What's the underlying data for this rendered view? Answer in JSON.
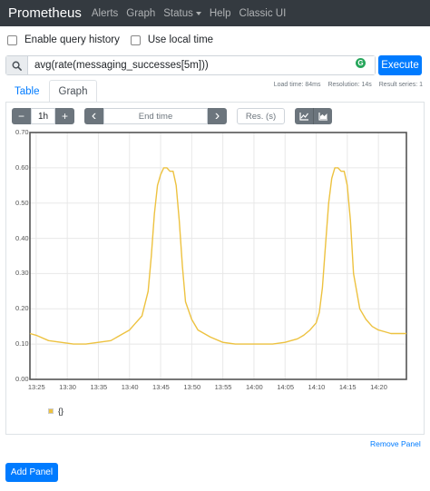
{
  "navbar": {
    "brand": "Prometheus",
    "links": [
      "Alerts",
      "Graph",
      "Status",
      "Help",
      "Classic UI"
    ]
  },
  "options": {
    "query_history_label": "Enable query history",
    "local_time_label": "Use local time"
  },
  "query": {
    "expression": "avg(rate(messaging_successes[5m]))",
    "badge": "G",
    "execute_label": "Execute"
  },
  "stats": {
    "load_time": "Load time: 84ms",
    "resolution": "Resolution: 14s",
    "result_series": "Result series: 1"
  },
  "tabs": [
    "Table",
    "Graph"
  ],
  "graph_controls": {
    "minus": "−",
    "range": "1h",
    "plus": "+",
    "prev": "‹",
    "end_time_placeholder": "End time",
    "next": "›",
    "resolution_placeholder": "Res. (s)"
  },
  "chart_data": {
    "type": "line",
    "y_ticks": [
      "0.00",
      "0.10",
      "0.20",
      "0.30",
      "0.40",
      "0.50",
      "0.60",
      "0.70"
    ],
    "ylim": [
      0,
      0.7
    ],
    "x_ticks": [
      "13:25",
      "13:30",
      "13:35",
      "13:40",
      "13:45",
      "13:50",
      "13:55",
      "14:00",
      "14:05",
      "14:10",
      "14:15",
      "14:20"
    ],
    "x_ticks_minutes": [
      0,
      5,
      10,
      15,
      20,
      25,
      30,
      35,
      40,
      45,
      50,
      55
    ],
    "xlim_minutes": [
      -1,
      59.5
    ],
    "grid": true,
    "series": [
      {
        "name": "{}",
        "color": "#edc240",
        "x_minutes": [
          -1,
          0,
          2,
          4,
          6,
          8,
          10,
          12,
          14,
          15,
          16,
          17,
          18,
          18.5,
          19,
          19.5,
          20,
          20.5,
          21,
          21.5,
          22,
          22.5,
          23,
          23.5,
          24,
          25,
          26,
          28,
          30,
          32,
          34,
          36,
          38,
          40,
          42,
          43,
          44,
          45,
          45.5,
          46,
          46.5,
          47,
          47.5,
          48,
          48.5,
          49,
          49.5,
          50,
          50.5,
          51,
          52,
          53,
          54,
          55,
          56,
          57,
          58,
          59,
          59.5
        ],
        "values": [
          0.13,
          0.125,
          0.11,
          0.105,
          0.1,
          0.1,
          0.105,
          0.11,
          0.13,
          0.14,
          0.16,
          0.18,
          0.25,
          0.35,
          0.47,
          0.55,
          0.58,
          0.6,
          0.6,
          0.59,
          0.59,
          0.55,
          0.45,
          0.32,
          0.22,
          0.17,
          0.14,
          0.12,
          0.105,
          0.1,
          0.1,
          0.1,
          0.1,
          0.105,
          0.115,
          0.125,
          0.14,
          0.16,
          0.19,
          0.26,
          0.38,
          0.5,
          0.57,
          0.6,
          0.6,
          0.59,
          0.59,
          0.55,
          0.45,
          0.3,
          0.2,
          0.17,
          0.15,
          0.14,
          0.135,
          0.13,
          0.13,
          0.13,
          0.13
        ]
      }
    ]
  },
  "legend": {
    "label": "{}"
  },
  "remove_panel_label": "Remove Panel",
  "add_panel_label": "Add Panel"
}
